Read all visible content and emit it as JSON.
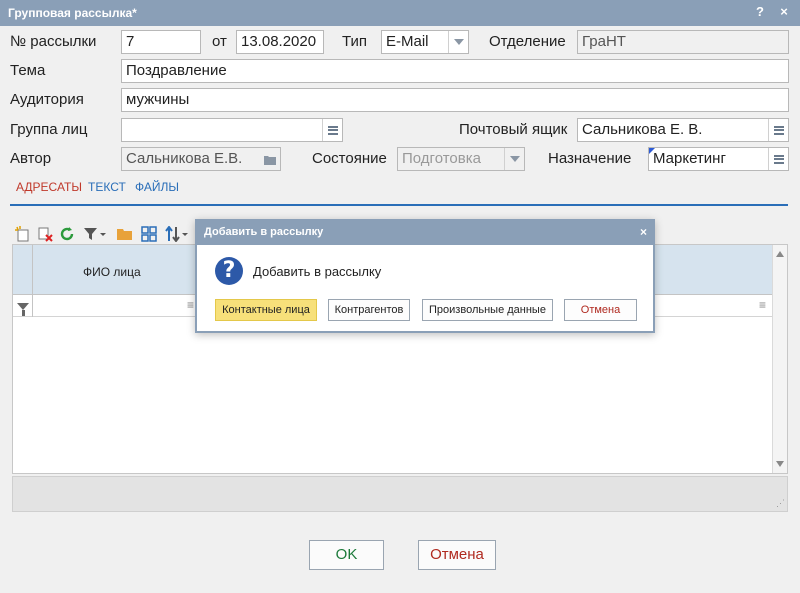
{
  "window": {
    "title": "Групповая рассылка*",
    "help_glyph": "?",
    "close_glyph": "×"
  },
  "form": {
    "number_label": "№ рассылки",
    "number_value": "7",
    "date_label": "от",
    "date_value": "13.08.2020",
    "type_label": "Тип",
    "type_value": "E-Mail",
    "dept_label": "Отделение",
    "dept_value": "ГраНТ",
    "subject_label": "Тема",
    "subject_value": "Поздравление",
    "audience_label": "Аудитория",
    "audience_value": "мужчины",
    "group_label": "Группа лиц",
    "group_value": "",
    "mailbox_label": "Почтовый ящик",
    "mailbox_value": "Сальникова Е. В.",
    "author_label": "Автор",
    "author_value": "Сальникова Е.В.",
    "state_label": "Состояние",
    "state_value": "Подготовка",
    "purpose_label": "Назначение",
    "purpose_value": "Маркетинг"
  },
  "tabs": [
    {
      "label": "АДРЕСАТЫ",
      "active": true
    },
    {
      "label": "ТЕКСТ",
      "active": false
    },
    {
      "label": "ФАЙЛЫ",
      "active": false
    }
  ],
  "grid": {
    "column_fio": "ФИО лица",
    "filter_dots": "≡"
  },
  "footer": {
    "ok_label": "OK",
    "cancel_label": "Отмена"
  },
  "modal": {
    "title": "Добавить в рассылку",
    "message": "Добавить в рассылку",
    "close_glyph": "×",
    "buttons": [
      "Контактные лица",
      "Контрагентов",
      "Произвольные данные",
      "Отмена"
    ]
  },
  "colors": {
    "titlebar": "#8a9fb7",
    "tab_active": "#c0392b",
    "tab_inactive": "#2a6eb8",
    "primary_button": "#f7e07a",
    "ok_text": "#1c7a3a",
    "cancel_text": "#b02a20"
  }
}
